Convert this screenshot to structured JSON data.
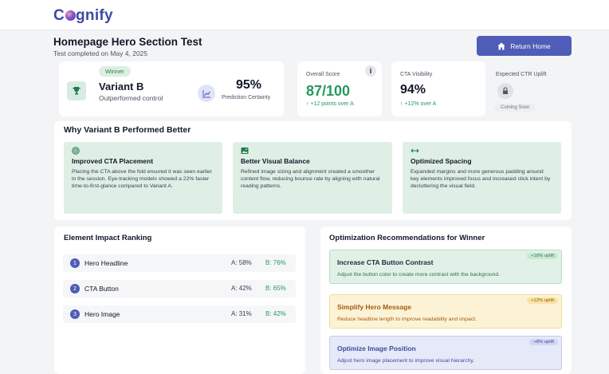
{
  "app": {
    "logo_prefix": "C",
    "logo_suffix": "gnify"
  },
  "header": {
    "title": "Homepage Hero Section Test",
    "subtitle": "Test completed on May 4, 2025",
    "return_label": "Return Home"
  },
  "winner": {
    "badge": "Winner",
    "name": "Variant B",
    "subtitle": "Outperformed control",
    "certainty_value": "95%",
    "certainty_label": "Prediction Certainty"
  },
  "metrics": {
    "overall_score": {
      "label": "Overall Score",
      "value": "87/100",
      "delta": "↑ +12 points over A"
    },
    "cta_visibility": {
      "label": "CTA Visibility",
      "value": "94%",
      "delta": "↑ +12% over A"
    },
    "expected_ctr": {
      "label": "Expected CTR Uplift",
      "status": "Coming Soon"
    }
  },
  "why": {
    "title": "Why Variant B Performed Better",
    "reasons": [
      {
        "icon": "target-icon",
        "title": "Improved CTA Placement",
        "description": "Placing the CTA above the fold ensured it was seen earlier in the session. Eye-tracking models showed a 22% faster time-to-first-glance compared to Variant A."
      },
      {
        "icon": "image-icon",
        "title": "Better Visual Balance",
        "description": "Refined image sizing and alignment created a smoother content flow, reducing bounce rate by aligning with natural reading patterns."
      },
      {
        "icon": "arrows-horizontal-icon",
        "title": "Optimized Spacing",
        "description": "Expanded margins and more generous padding around key elements improved focus and increased click intent by decluttering the visual field."
      }
    ]
  },
  "ranking": {
    "title": "Element Impact Ranking",
    "rows": [
      {
        "rank": "1",
        "label": "Hero Headline",
        "a": "A: 58%",
        "b": "B: 76%"
      },
      {
        "rank": "2",
        "label": "CTA Button",
        "a": "A: 42%",
        "b": "B: 65%"
      },
      {
        "rank": "3",
        "label": "Hero Image",
        "a": "A: 31%",
        "b": "B: 42%"
      }
    ]
  },
  "recommendations": {
    "title": "Optimization Recommendations for Winner",
    "items": [
      {
        "title": "Increase CTA Button Contrast",
        "description": "Adjust the button color to create more contrast with the background.",
        "badge": "+18% uplift",
        "color": "#e1f1e7"
      },
      {
        "title": "Simplify Hero Message",
        "description": "Reduce headline length to improve readability and impact.",
        "badge": "+12% uplift",
        "color": "#fcf3d6"
      },
      {
        "title": "Optimize Image Position",
        "description": "Adjust hero image placement to improve visual hierarchy.",
        "badge": "+8% uplift",
        "color": "#e6e9f7"
      }
    ]
  },
  "colors": {
    "primary": "#4f5cb8",
    "success": "#239a5e",
    "warning": "#a35a10"
  }
}
